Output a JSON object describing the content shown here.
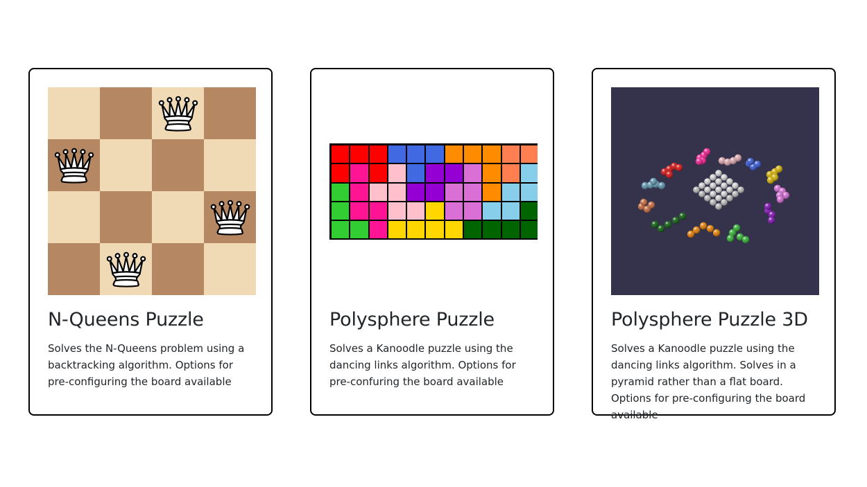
{
  "cards": [
    {
      "title": "N-Queens Puzzle",
      "description": "Solves the N-Queens problem using a backtracking algorithm. Options for pre-configuring the board available"
    },
    {
      "title": "Polysphere Puzzle",
      "description": "Solves a Kanoodle puzzle using the dancing links algorithm. Options for pre-confuring the board available"
    },
    {
      "title": "Polysphere Puzzle 3D",
      "description": "Solves a Kanoodle puzzle using the dancing links algorithm. Solves in a pyramid rather than a flat board. Options for pre-configuring the board available"
    }
  ],
  "queens_board": {
    "size": 4,
    "queen_positions": [
      [
        0,
        2
      ],
      [
        1,
        0
      ],
      [
        2,
        3
      ],
      [
        3,
        1
      ]
    ],
    "colors": {
      "light": "#f0d9b5",
      "dark": "#b58863"
    }
  },
  "polysphere_grid": {
    "rows": [
      [
        "#ff0000",
        "#ff0000",
        "#ff0000",
        "#4169e1",
        "#4169e1",
        "#4169e1",
        "#ff8c00",
        "#ff8c00",
        "#ff8c00",
        "#ff7f50",
        "#ff7f50"
      ],
      [
        "#ff0000",
        "#ff1493",
        "#ff0000",
        "#ffc0cb",
        "#4169e1",
        "#9400d3",
        "#9400d3",
        "#da70d6",
        "#ff8c00",
        "#ff7f50",
        "#87ceeb"
      ],
      [
        "#32cd32",
        "#ff1493",
        "#ffc0cb",
        "#ffc0cb",
        "#9400d3",
        "#9400d3",
        "#da70d6",
        "#da70d6",
        "#ff8c00",
        "#87ceeb",
        "#87ceeb"
      ],
      [
        "#32cd32",
        "#ff1493",
        "#ff1493",
        "#ffc0cb",
        "#ffc0cb",
        "#ffd700",
        "#da70d6",
        "#da70d6",
        "#87ceeb",
        "#87ceeb",
        "#006400"
      ],
      [
        "#32cd32",
        "#32cd32",
        "#ff1493",
        "#ffd700",
        "#ffd700",
        "#ffd700",
        "#ffd700",
        "#006400",
        "#006400",
        "#006400",
        "#006400"
      ]
    ]
  },
  "scene_background": "#35324b"
}
